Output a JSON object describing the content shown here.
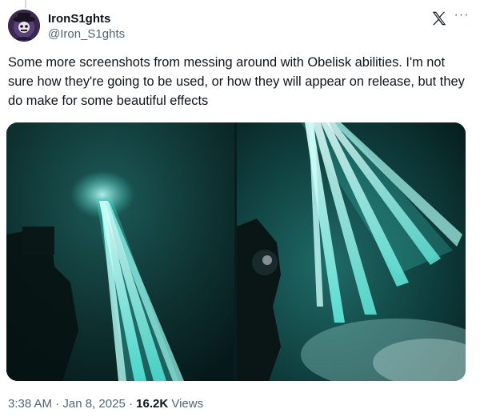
{
  "author": {
    "display_name": "IronS1ghts",
    "handle": "@Iron_S1ghts"
  },
  "icons": {
    "logo": "x-logo-icon",
    "more": "more-options-icon"
  },
  "tweet": {
    "text": "Some more screenshots from messing around with Obelisk abilities. I'm not sure how they're going to be used, or how they will appear on release, but they do make for some beautiful effects"
  },
  "meta": {
    "time": "3:38 AM",
    "separator_1": " · ",
    "date": "Jan 8, 2025",
    "separator_2": " · ",
    "views_count": "16.2K",
    "views_label": " Views"
  },
  "colors": {
    "text": "#0f1419",
    "secondary": "#536471",
    "beam": "#7ff9f0",
    "scene": "#0c3a38"
  }
}
